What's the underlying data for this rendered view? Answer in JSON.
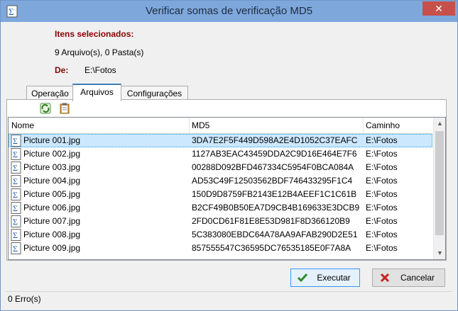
{
  "window": {
    "title": "Verificar somas de verificação MD5",
    "close_label": "✕"
  },
  "summary": {
    "selected_heading": "Itens selecionados:",
    "selected_count": "9 Arquivo(s), 0 Pasta(s)",
    "from_label": "De:",
    "from_value": "E:\\Fotos"
  },
  "tabs": [
    {
      "label": "Operação",
      "active": false
    },
    {
      "label": "Arquivos",
      "active": true
    },
    {
      "label": "Configurações",
      "active": false
    }
  ],
  "toolbar": {
    "refresh_icon": "refresh-icon",
    "clipboard_icon": "clipboard-icon"
  },
  "list": {
    "columns": [
      "Nome",
      "MD5",
      "Caminho"
    ],
    "rows": [
      {
        "name": "Picture 001.jpg",
        "md5": "3DA7E2F5F449D598A2E4D1052C37EAFC",
        "path": "E:\\Fotos",
        "selected": true
      },
      {
        "name": "Picture 002.jpg",
        "md5": "1127AB3EAC43459DDA2C9D16E464E7F6",
        "path": "E:\\Fotos"
      },
      {
        "name": "Picture 003.jpg",
        "md5": "00288D092BFD467334C5954F0BCA084A",
        "path": "E:\\Fotos"
      },
      {
        "name": "Picture 004.jpg",
        "md5": "AD53C49F12503562BDF746433295F1C4",
        "path": "E:\\Fotos"
      },
      {
        "name": "Picture 005.jpg",
        "md5": "150D9D8759FB2143E12B4AEEF1C1C61B",
        "path": "E:\\Fotos"
      },
      {
        "name": "Picture 006.jpg",
        "md5": "B2CF49B0B50EA7D9CB4B169633E3DCB9",
        "path": "E:\\Fotos"
      },
      {
        "name": "Picture 007.jpg",
        "md5": "2FD0CD61F81E8E53D981F8D366120B9",
        "path": "E:\\Fotos"
      },
      {
        "name": "Picture 008.jpg",
        "md5": "5C383080EBDC64A78AA9AFAB290D2E51",
        "path": "E:\\Fotos"
      },
      {
        "name": "Picture 009.jpg",
        "md5": "857555547C36595DC76535185E0F7A8A",
        "path": "E:\\Fotos"
      }
    ]
  },
  "buttons": {
    "execute": "Executar",
    "cancel": "Cancelar"
  },
  "status": {
    "errors": "0 Erro(s)"
  },
  "colors": {
    "accent": "#3c7fb1",
    "heading": "#8b0000",
    "selection": "#cce8ff"
  }
}
